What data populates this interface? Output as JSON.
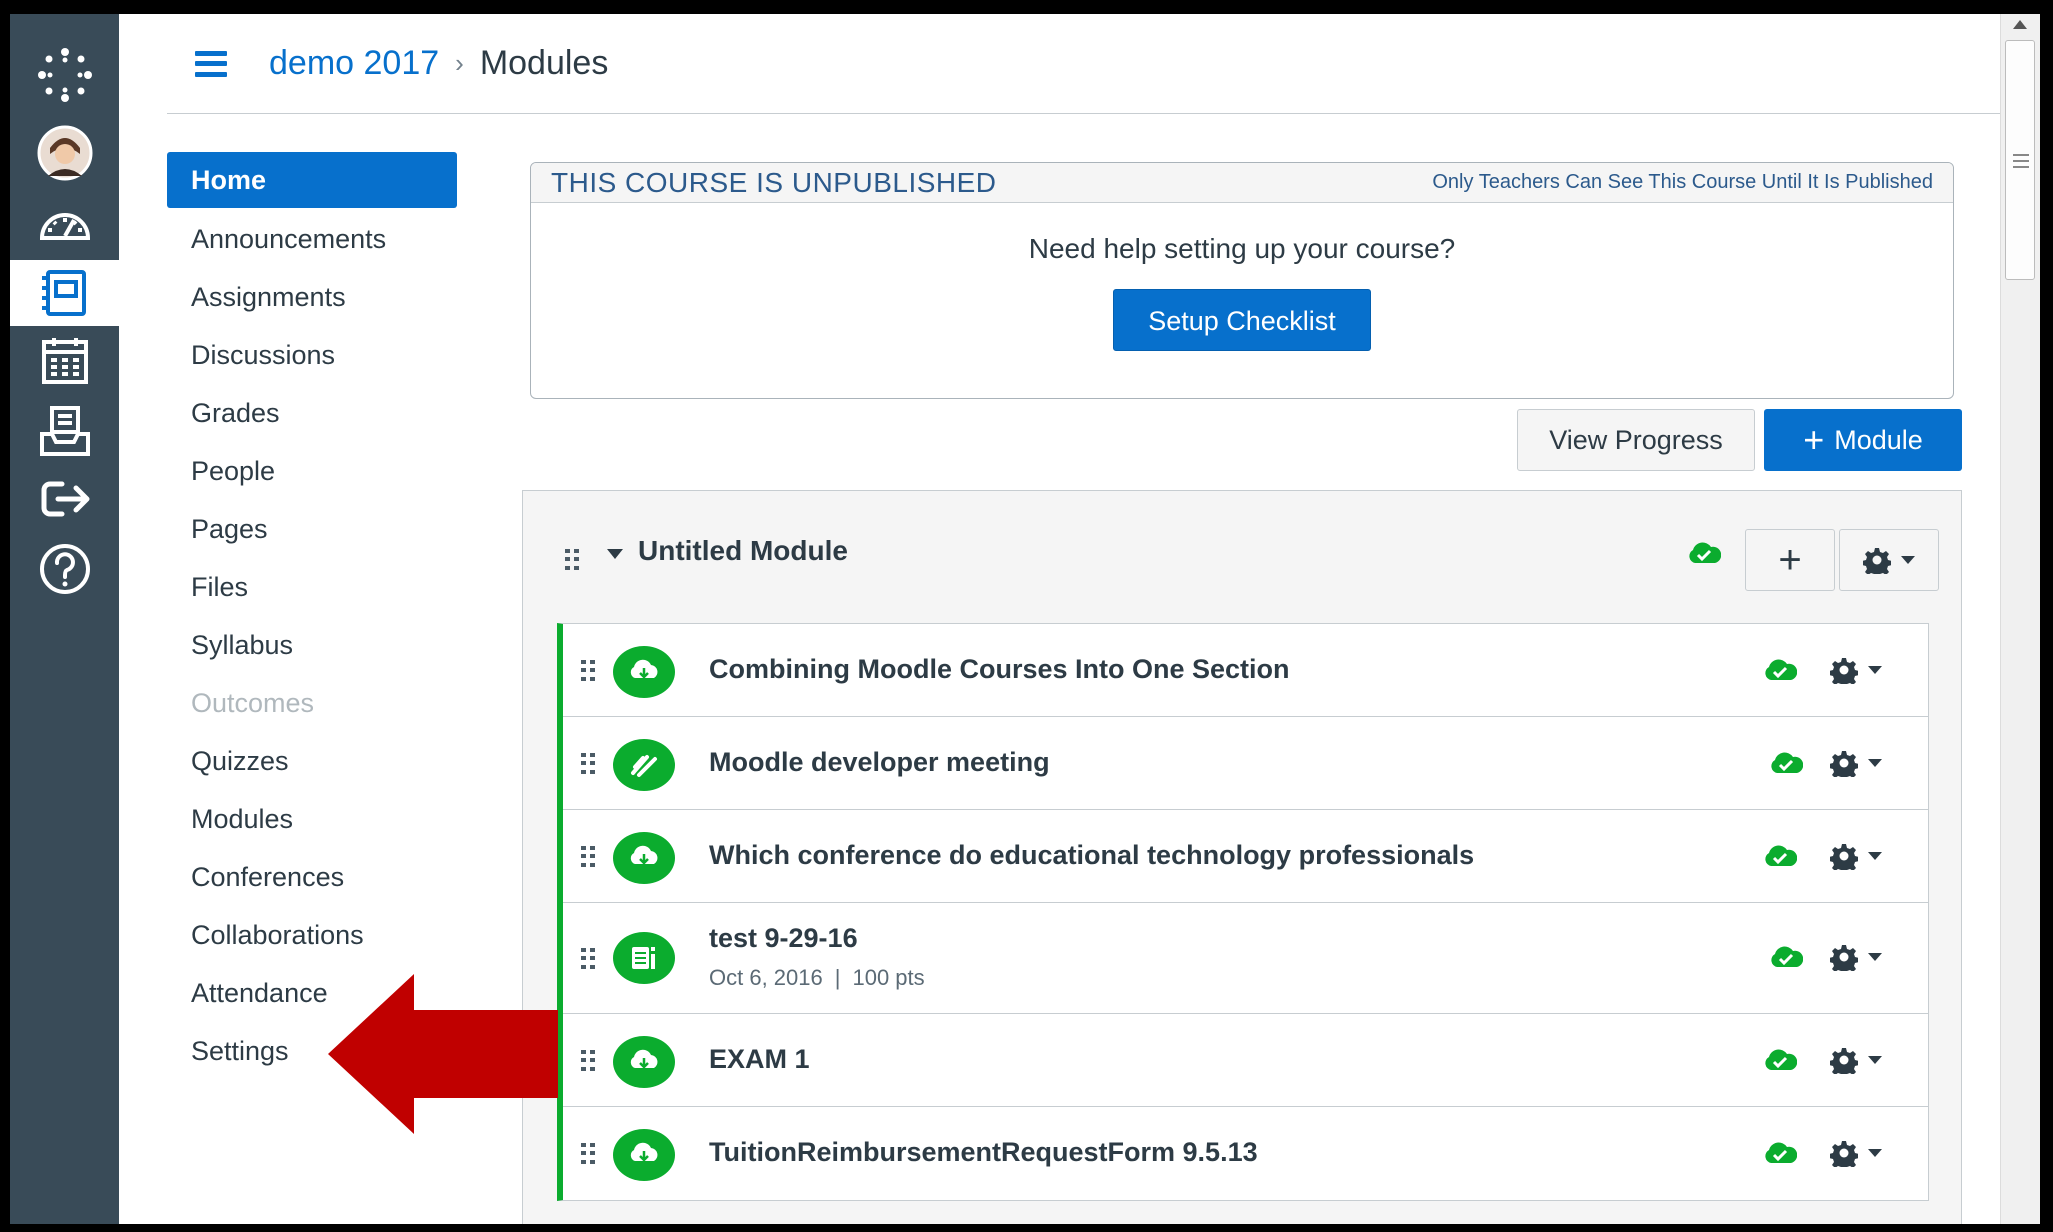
{
  "colors": {
    "brand_blue": "#0770cc",
    "nav_dark": "#394b58",
    "published_green": "#0bac2e",
    "arrow_red": "#c00000"
  },
  "global_nav": [
    {
      "icon": "canvas-logo-icon"
    },
    {
      "icon": "user-avatar-icon"
    },
    {
      "icon": "dashboard-icon"
    },
    {
      "icon": "courses-icon",
      "active": true
    },
    {
      "icon": "calendar-icon"
    },
    {
      "icon": "inbox-icon"
    },
    {
      "icon": "commons-icon"
    },
    {
      "icon": "help-icon"
    }
  ],
  "header": {
    "course_link": "demo 2017",
    "separator": "›",
    "current": "Modules"
  },
  "course_nav": [
    {
      "label": "Home",
      "active": true
    },
    {
      "label": "Announcements"
    },
    {
      "label": "Assignments"
    },
    {
      "label": "Discussions"
    },
    {
      "label": "Grades"
    },
    {
      "label": "People"
    },
    {
      "label": "Pages"
    },
    {
      "label": "Files"
    },
    {
      "label": "Syllabus"
    },
    {
      "label": "Outcomes",
      "disabled": true
    },
    {
      "label": "Quizzes"
    },
    {
      "label": "Modules"
    },
    {
      "label": "Conferences"
    },
    {
      "label": "Collaborations"
    },
    {
      "label": "Attendance"
    },
    {
      "label": "Settings"
    }
  ],
  "unpublished_panel": {
    "title": "THIS COURSE IS UNPUBLISHED",
    "note": "Only Teachers Can See This Course Until It Is Published",
    "question": "Need help setting up your course?",
    "button": "Setup Checklist"
  },
  "toolbar": {
    "view_progress": "View Progress",
    "add_module_plus": "+",
    "add_module": "Module"
  },
  "module": {
    "title": "Untitled Module",
    "add_label": "+",
    "items": [
      {
        "title": "Combining Moodle Courses Into One Section",
        "icon": "external-tool-icon"
      },
      {
        "title": "Moodle developer meeting",
        "icon": "discussion-icon"
      },
      {
        "title": "Which conference do educational technology professionals",
        "icon": "external-tool-icon"
      },
      {
        "title": "test 9-29-16",
        "icon": "quiz-icon",
        "date": "Oct 6, 2016",
        "meta_sep": "|",
        "points": "100 pts"
      },
      {
        "title": "EXAM 1",
        "icon": "external-tool-icon"
      },
      {
        "title": "TuitionReimbursementRequestForm 9.5.13",
        "icon": "external-tool-icon"
      }
    ]
  }
}
